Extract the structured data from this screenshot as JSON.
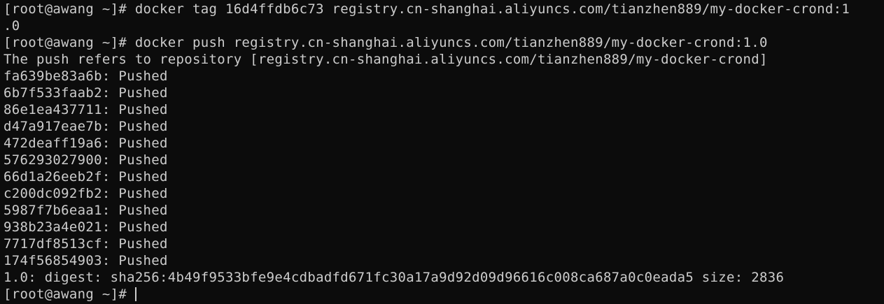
{
  "terminal": {
    "lines": [
      "[root@awang ~]# docker tag 16d4ffdb6c73 registry.cn-shanghai.aliyuncs.com/tianzhen889/my-docker-crond:1",
      ".0",
      "[root@awang ~]# docker push registry.cn-shanghai.aliyuncs.com/tianzhen889/my-docker-crond:1.0",
      "The push refers to repository [registry.cn-shanghai.aliyuncs.com/tianzhen889/my-docker-crond]",
      "fa639be83a6b: Pushed",
      "6b7f533faab2: Pushed",
      "86e1ea437711: Pushed",
      "d47a917eae7b: Pushed",
      "472deaff19a6: Pushed",
      "576293027900: Pushed",
      "66d1a26eeb2f: Pushed",
      "c200dc092fb2: Pushed",
      "5987f7b6eaa1: Pushed",
      "938b23a4e021: Pushed",
      "7717df8513cf: Pushed",
      "174f56854903: Pushed",
      "1.0: digest: sha256:4b49f9533bfe9e4cdbadfd671fc30a17a9d92d09d96616c008ca687a0c0eada5 size: 2836"
    ],
    "prompt": "[root@awang ~]# ",
    "colors": {
      "background": "#0c0c0c",
      "foreground": "#cccccc"
    }
  }
}
